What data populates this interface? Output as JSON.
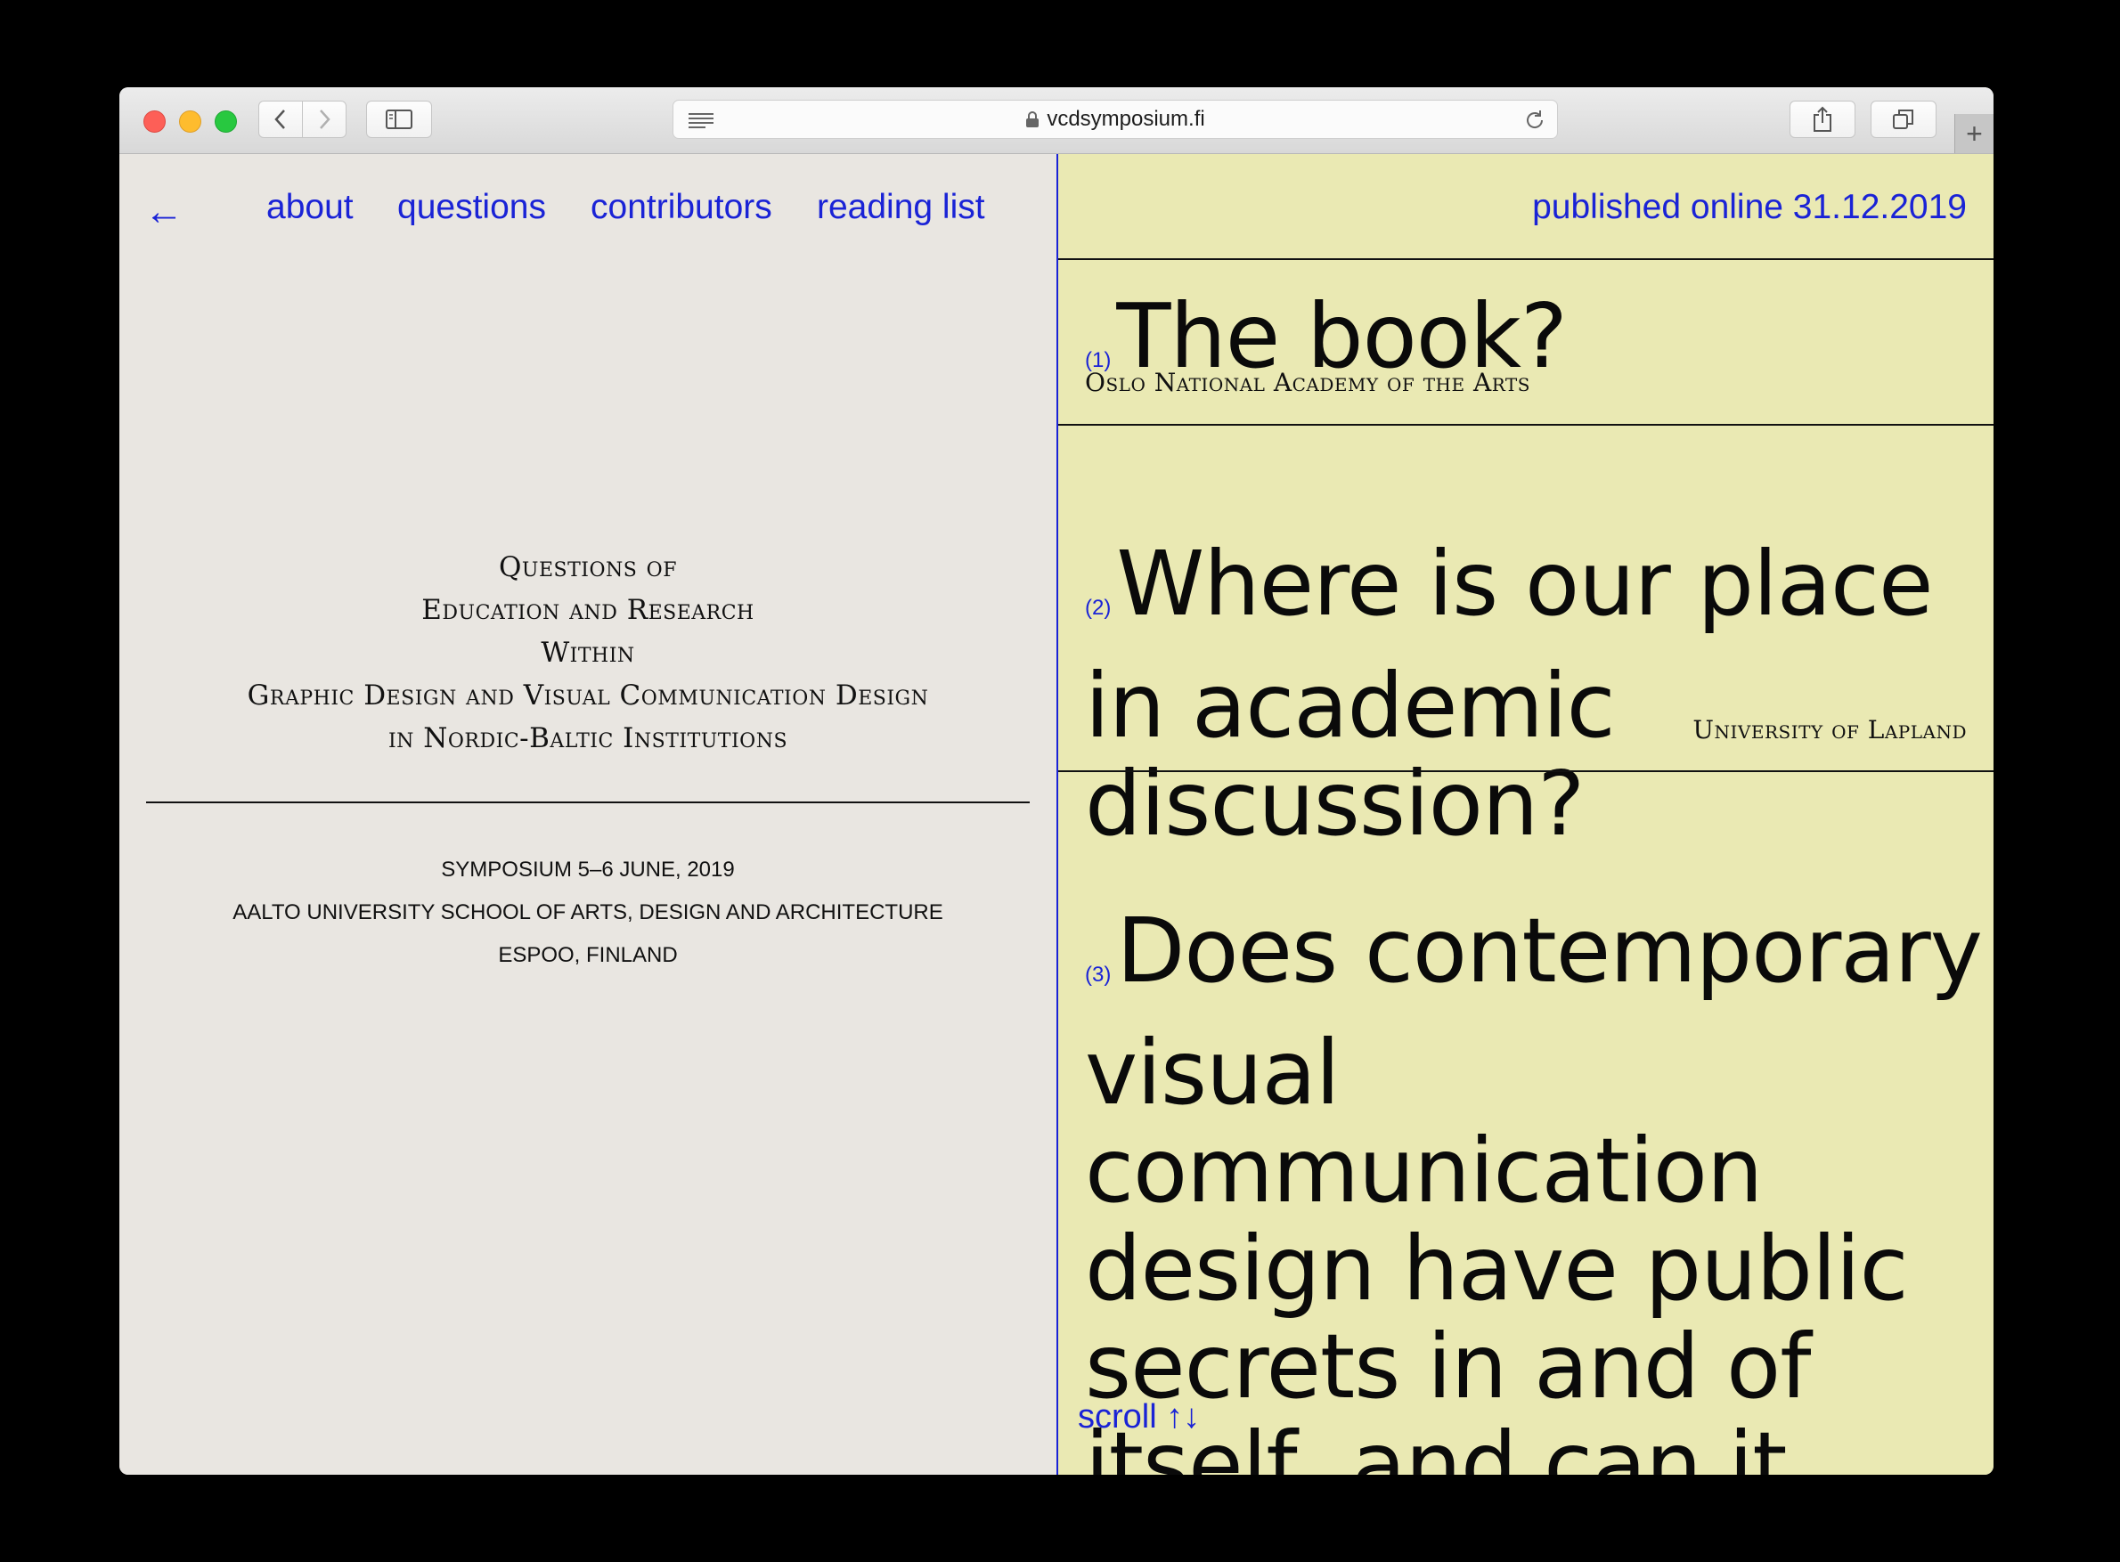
{
  "browser": {
    "url": "vcdsymposium.fi",
    "new_tab_symbol": "+"
  },
  "nav": {
    "back_arrow": "←",
    "items": [
      {
        "label": "about"
      },
      {
        "label": "questions"
      },
      {
        "label": "contributors"
      },
      {
        "label": "reading list"
      }
    ]
  },
  "title": {
    "lines": [
      "Questions of",
      "Education and Research",
      "Within",
      "Graphic Design and Visual Communication Design",
      "in Nordic-Baltic Institutions"
    ]
  },
  "info": {
    "lines": [
      "SYMPOSIUM 5–6 JUNE, 2019",
      "AALTO UNIVERSITY SCHOOL OF ARTS, DESIGN AND ARCHITECTURE",
      "ESPOO, FINLAND"
    ]
  },
  "published": "published online 31.12.2019",
  "questions": [
    {
      "number": "(1)",
      "text": "The book?",
      "institution": "Oslo National Academy of the Arts"
    },
    {
      "number": "(2)",
      "text": "Where is our place in academic discussion?",
      "institution": "University of Lapland"
    },
    {
      "number": "(3)",
      "text": "Does contemporary visual communication design have public secrets in and of itself, and can it unveil its own public"
    }
  ],
  "scroll_label": "scroll ↑↓",
  "colors": {
    "link_blue": "#1a23d6",
    "left_bg": "#e9e6e1",
    "right_bg": "#eae9b3"
  }
}
